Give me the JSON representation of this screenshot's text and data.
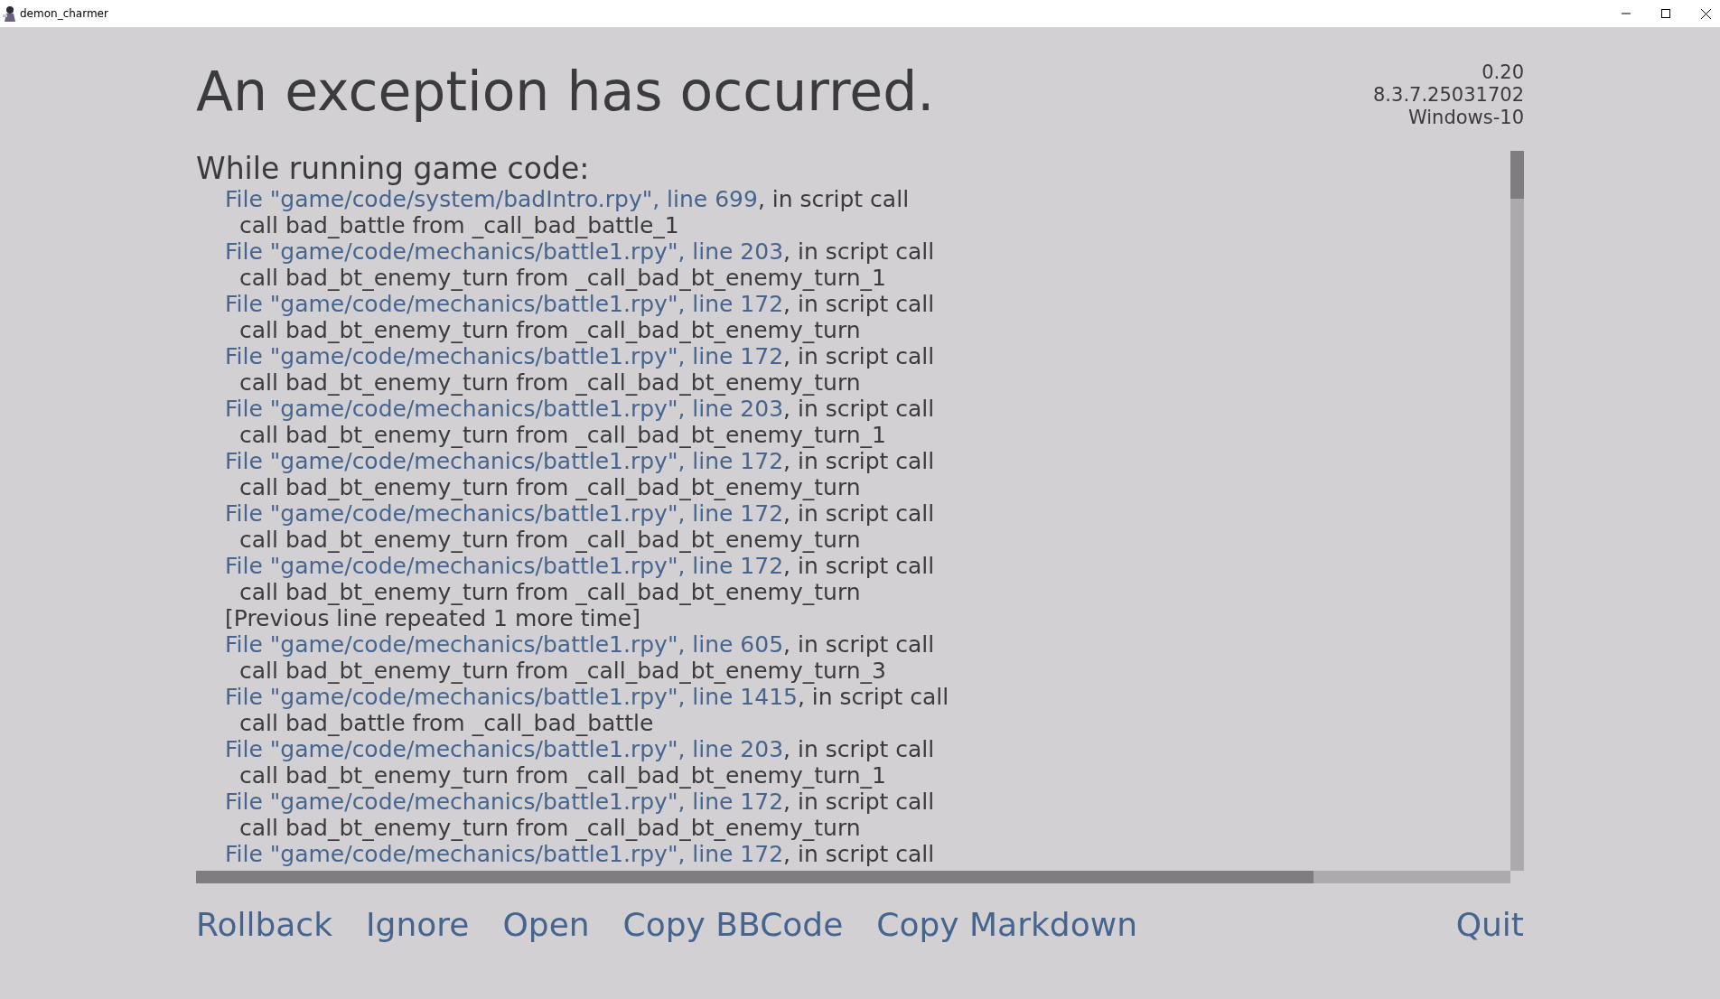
{
  "window": {
    "title": "demon_charmer"
  },
  "heading": "An exception has occurred.",
  "version_info": [
    "0.20",
    "8.3.7.25031702",
    "Windows-10"
  ],
  "section_title": "While running game code:",
  "traceback": [
    {
      "kind": "frame",
      "link": "File \"game/code/system/badIntro.rpy\", line 699",
      "suffix": ", in script call",
      "call": "call bad_battle from _call_bad_battle_1"
    },
    {
      "kind": "frame",
      "link": "File \"game/code/mechanics/battle1.rpy\", line 203",
      "suffix": ", in script call",
      "call": "call bad_bt_enemy_turn from _call_bad_bt_enemy_turn_1"
    },
    {
      "kind": "frame",
      "link": "File \"game/code/mechanics/battle1.rpy\", line 172",
      "suffix": ", in script call",
      "call": "call bad_bt_enemy_turn from _call_bad_bt_enemy_turn"
    },
    {
      "kind": "frame",
      "link": "File \"game/code/mechanics/battle1.rpy\", line 172",
      "suffix": ", in script call",
      "call": "call bad_bt_enemy_turn from _call_bad_bt_enemy_turn"
    },
    {
      "kind": "frame",
      "link": "File \"game/code/mechanics/battle1.rpy\", line 203",
      "suffix": ", in script call",
      "call": "call bad_bt_enemy_turn from _call_bad_bt_enemy_turn_1"
    },
    {
      "kind": "frame",
      "link": "File \"game/code/mechanics/battle1.rpy\", line 172",
      "suffix": ", in script call",
      "call": "call bad_bt_enemy_turn from _call_bad_bt_enemy_turn"
    },
    {
      "kind": "frame",
      "link": "File \"game/code/mechanics/battle1.rpy\", line 172",
      "suffix": ", in script call",
      "call": "call bad_bt_enemy_turn from _call_bad_bt_enemy_turn"
    },
    {
      "kind": "frame",
      "link": "File \"game/code/mechanics/battle1.rpy\", line 172",
      "suffix": ", in script call",
      "call": "call bad_bt_enemy_turn from _call_bad_bt_enemy_turn"
    },
    {
      "kind": "note",
      "text": "[Previous line repeated 1 more time]"
    },
    {
      "kind": "frame",
      "link": "File \"game/code/mechanics/battle1.rpy\", line 605",
      "suffix": ", in script call",
      "call": "call bad_bt_enemy_turn from _call_bad_bt_enemy_turn_3"
    },
    {
      "kind": "frame",
      "link": "File \"game/code/mechanics/battle1.rpy\", line 1415",
      "suffix": ", in script call",
      "call": "call bad_battle from _call_bad_battle"
    },
    {
      "kind": "frame",
      "link": "File \"game/code/mechanics/battle1.rpy\", line 203",
      "suffix": ", in script call",
      "call": "call bad_bt_enemy_turn from _call_bad_bt_enemy_turn_1"
    },
    {
      "kind": "frame",
      "link": "File \"game/code/mechanics/battle1.rpy\", line 172",
      "suffix": ", in script call",
      "call": "call bad_bt_enemy_turn from _call_bad_bt_enemy_turn"
    },
    {
      "kind": "frame",
      "link": "File \"game/code/mechanics/battle1.rpy\", line 172",
      "suffix": ", in script call"
    }
  ],
  "actions": [
    "Rollback",
    "Ignore",
    "Open",
    "Copy BBCode",
    "Copy Markdown"
  ],
  "quit": "Quit"
}
